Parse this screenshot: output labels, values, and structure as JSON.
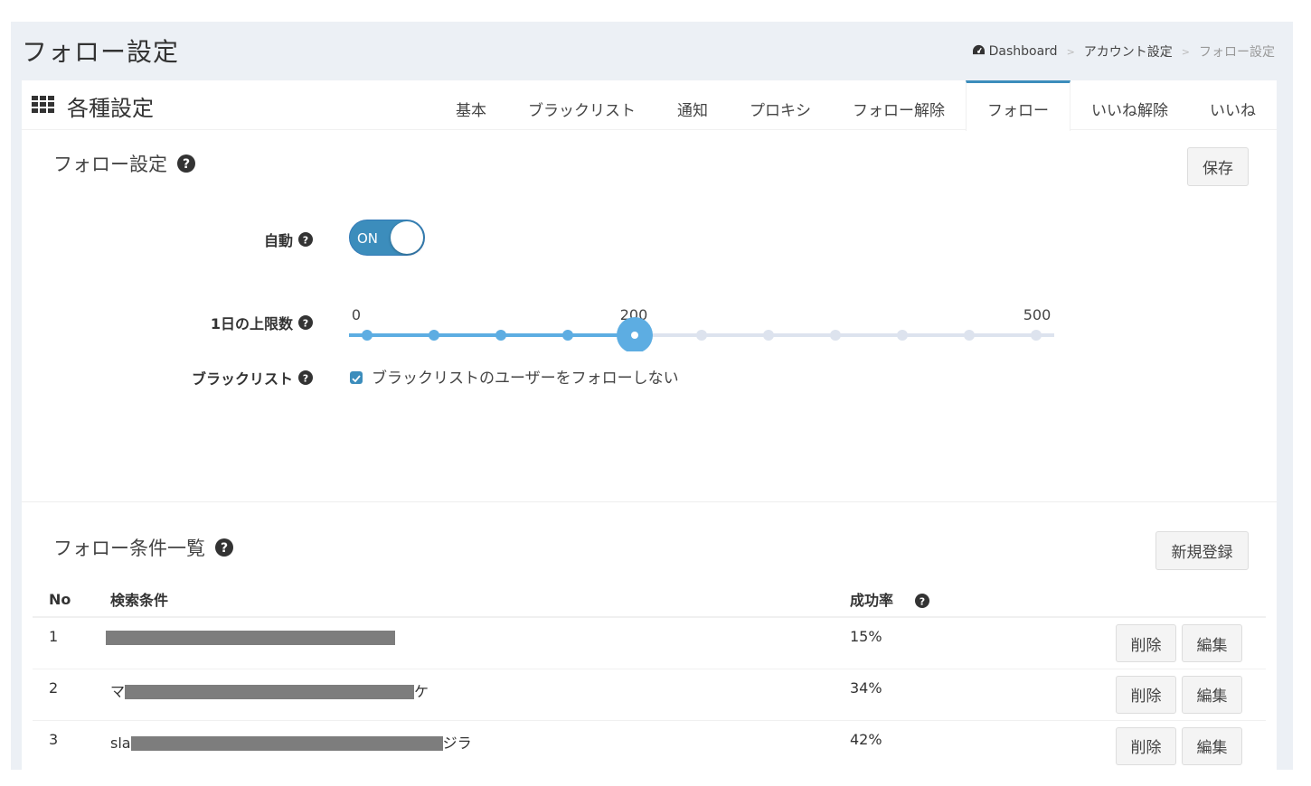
{
  "page": {
    "title": "フォロー設定",
    "breadcrumb": {
      "dashboard": "Dashboard",
      "account": "アカウント設定",
      "current": "フォロー設定"
    }
  },
  "box": {
    "title": "各種設定",
    "tabs": [
      {
        "label": "基本",
        "active": false
      },
      {
        "label": "ブラックリスト",
        "active": false
      },
      {
        "label": "通知",
        "active": false
      },
      {
        "label": "プロキシ",
        "active": false
      },
      {
        "label": "フォロー解除",
        "active": false
      },
      {
        "label": "フォロー",
        "active": true
      },
      {
        "label": "いいね解除",
        "active": false
      },
      {
        "label": "いいね",
        "active": false
      }
    ]
  },
  "follow_settings": {
    "title": "フォロー設定",
    "save_label": "保存",
    "auto": {
      "label": "自動",
      "state": "ON"
    },
    "daily_limit": {
      "label": "1日の上限数",
      "min_label": "0",
      "mid_label": "200",
      "max_label": "500",
      "min": 0,
      "max": 500,
      "value": 200,
      "steps": 11
    },
    "blacklist": {
      "label": "ブラックリスト",
      "checkbox_label": "ブラックリストのユーザーをフォローしない",
      "checked": true
    }
  },
  "conditions": {
    "title": "フォロー条件一覧",
    "new_label": "新規登録",
    "columns": {
      "no": "No",
      "query": "検索条件",
      "rate": "成功率"
    },
    "delete_label": "削除",
    "edit_label": "編集",
    "rows": [
      {
        "no": "1",
        "query_prefix": "",
        "query_suffix": "",
        "rate": "15%"
      },
      {
        "no": "2",
        "query_prefix": "マ",
        "query_suffix": "ケ",
        "rate": "34%"
      },
      {
        "no": "3",
        "query_prefix": "sla",
        "query_suffix": "ジラ",
        "rate": "42%"
      }
    ]
  },
  "colors": {
    "accent": "#3c8dbc",
    "slider": "#5dade2",
    "track": "#dde3ee"
  }
}
